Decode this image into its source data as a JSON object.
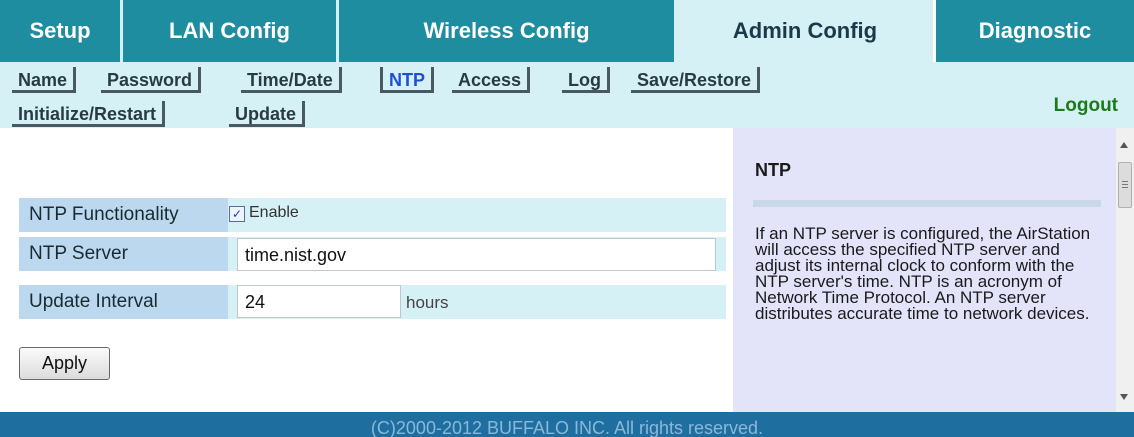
{
  "top_tabs": [
    {
      "label": "Setup"
    },
    {
      "label": "LAN Config"
    },
    {
      "label": "Wireless Config"
    },
    {
      "label": "Admin Config",
      "active": true
    },
    {
      "label": "Diagnostic"
    }
  ],
  "sub_tabs": [
    {
      "label": "Name"
    },
    {
      "label": "Password"
    },
    {
      "label": "Time/Date"
    },
    {
      "label": "NTP",
      "active": true
    },
    {
      "label": "Access"
    },
    {
      "label": "Log"
    },
    {
      "label": "Save/Restore"
    },
    {
      "label": "Initialize/Restart"
    },
    {
      "label": "Update"
    }
  ],
  "logout_label": "Logout",
  "form": {
    "ntp_functionality": {
      "label": "NTP Functionality",
      "checkbox_label": "Enable",
      "checked": true
    },
    "ntp_server": {
      "label": "NTP Server",
      "value": "time.nist.gov"
    },
    "update_interval": {
      "label": "Update Interval",
      "value": "24",
      "unit": "hours"
    }
  },
  "apply_label": "Apply",
  "help": {
    "title": "NTP",
    "text": "If an NTP server is configured, the AirStation will access the specified NTP server and adjust its internal clock to conform with the NTP server's time. NTP is an acronym of Network Time Protocol. An NTP server distributes accurate time to network devices."
  },
  "footer": "(C)2000-2012 BUFFALO INC. All rights reserved.",
  "colors": {
    "tab_bg": "#1e8da0",
    "nav_bg": "#d6f1f5",
    "label_bg": "#bcd8ee",
    "help_bg": "#e3e3fa",
    "footer_bg": "#1e6fa0",
    "logout": "#1b7a1b",
    "active_subtab": "#1e4fd6"
  }
}
